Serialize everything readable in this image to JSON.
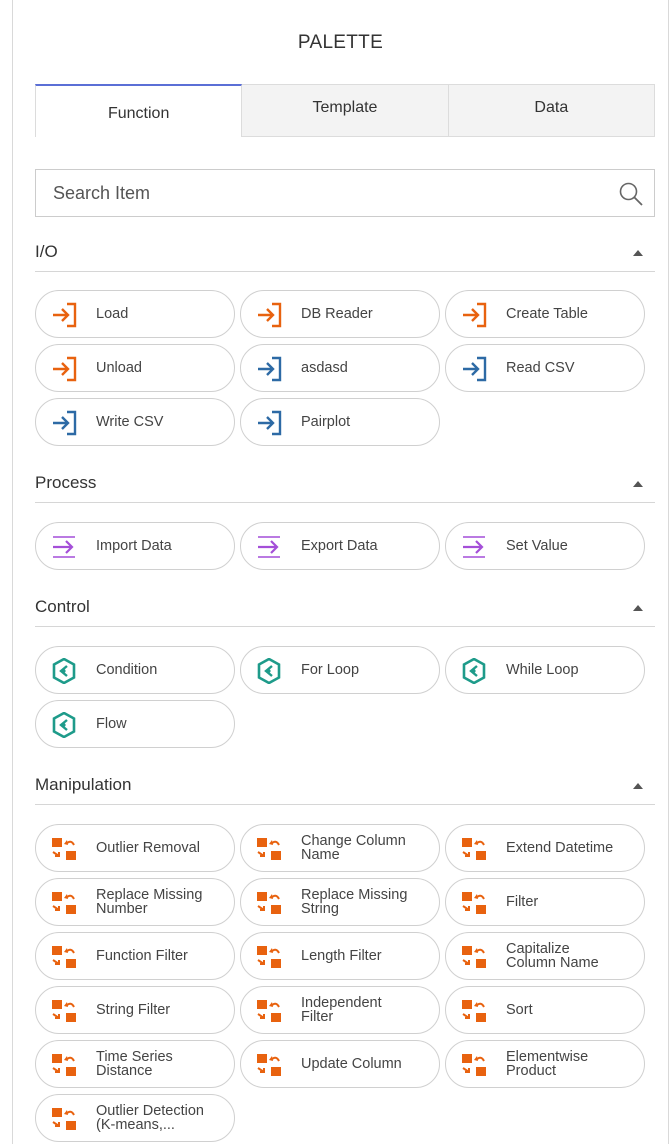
{
  "palette": {
    "title": "PALETTE",
    "tabs": [
      {
        "label": "Function",
        "active": true
      },
      {
        "label": "Template",
        "active": false
      },
      {
        "label": "Data",
        "active": false
      }
    ],
    "search": {
      "placeholder": "Search Item",
      "value": ""
    },
    "colors": {
      "io_orange": "#e8620f",
      "io_blue": "#2d6aa5",
      "process_purple": "#a44fd8",
      "control_teal": "#1e9b8a",
      "manip_orange": "#e8620f",
      "tab_accent": "#5b6fd6"
    },
    "sections": [
      {
        "label": "I/O",
        "icon": "arrow-into-box-icon",
        "items": [
          "Load",
          "DB Reader",
          "Create Table",
          "Unload",
          "asdasd",
          "Read CSV",
          "Write CSV",
          "Pairplot"
        ]
      },
      {
        "label": "Process",
        "icon": "arrow-right-icon",
        "items": [
          "Import Data",
          "Export Data",
          "Set Value"
        ]
      },
      {
        "label": "Control",
        "icon": "hexagon-control-icon",
        "items": [
          "Condition",
          "For Loop",
          "While Loop",
          "Flow"
        ]
      },
      {
        "label": "Manipulation",
        "icon": "transform-squares-icon",
        "items": [
          "Outlier Removal",
          "Change Column\nName",
          "Extend Datetime",
          "Replace Missing\nNumber",
          "Replace Missing\nString",
          "Filter",
          "Function Filter",
          "Length Filter",
          "Capitalize\nColumn Name",
          "String Filter",
          "Independent\nFilter",
          "Sort",
          "Time Series\nDistance",
          "Update Column",
          "Elementwise\nProduct",
          "Outlier Detection\n(K-means,..."
        ]
      }
    ]
  }
}
